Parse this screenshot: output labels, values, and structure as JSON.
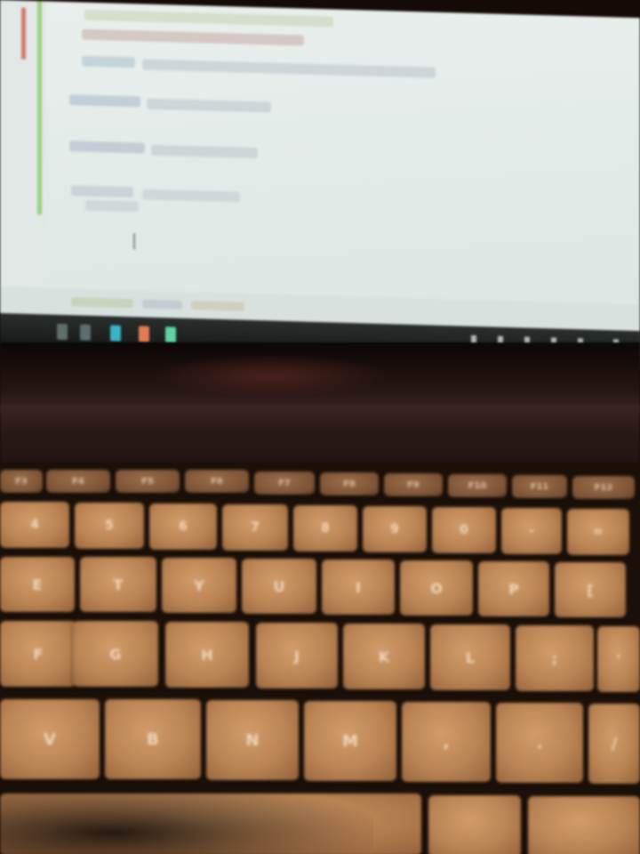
{
  "keyboard": {
    "row_function": [
      {
        "label": "F3"
      },
      {
        "label": "F4"
      },
      {
        "label": "F5"
      },
      {
        "label": "F6"
      },
      {
        "label": "F7"
      },
      {
        "label": "F8"
      },
      {
        "label": "F9"
      },
      {
        "label": "F10"
      },
      {
        "label": "F11"
      },
      {
        "label": "F12"
      }
    ],
    "row_number": [
      {
        "label": "4"
      },
      {
        "label": "5"
      },
      {
        "label": "6"
      },
      {
        "label": "7"
      },
      {
        "label": "8"
      },
      {
        "label": "9"
      },
      {
        "label": "0"
      },
      {
        "label": "-"
      },
      {
        "label": "="
      }
    ],
    "row_top": [
      {
        "label": "E"
      },
      {
        "label": "T"
      },
      {
        "label": "Y"
      },
      {
        "label": "U"
      },
      {
        "label": "I"
      },
      {
        "label": "O"
      },
      {
        "label": "P"
      },
      {
        "label": "["
      }
    ],
    "row_home": [
      {
        "label": "F"
      },
      {
        "label": "G"
      },
      {
        "label": "H"
      },
      {
        "label": "J"
      },
      {
        "label": "K"
      },
      {
        "label": "L"
      },
      {
        "label": ";"
      },
      {
        "label": "'"
      }
    ],
    "row_bottom": [
      {
        "label": "V"
      },
      {
        "label": "B"
      },
      {
        "label": "N"
      },
      {
        "label": "M"
      },
      {
        "label": ","
      },
      {
        "label": "."
      },
      {
        "label": "/"
      }
    ]
  },
  "colors": {
    "screen": "#e6ece9",
    "key_backlight": "#c48d5b",
    "key_text": "#f4e2cd",
    "chassis": "#1b1009"
  }
}
